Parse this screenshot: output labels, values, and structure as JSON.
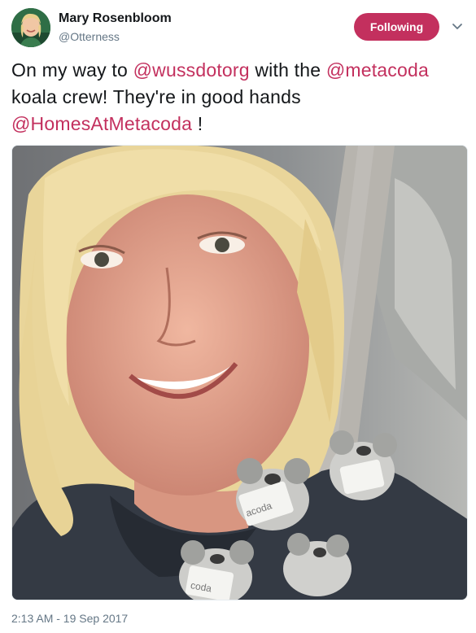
{
  "author": {
    "name": "Mary Rosenbloom",
    "handle": "@Otterness",
    "avatar_icon": "profile-photo"
  },
  "follow_button": {
    "label": "Following",
    "color": "#c3305e"
  },
  "menu": {
    "icon": "chevron-down-icon"
  },
  "tweet": {
    "text_1": "On my way to ",
    "mention_1": "@wussdotorg",
    "text_2": " with the ",
    "mention_2": "@metacoda",
    "text_3": " koala crew!  They're in good hands ",
    "mention_3": "@HomesAtMetacoda",
    "text_4": " !"
  },
  "photo": {
    "description_icon": "selfie-photo",
    "koala_tag_1": "acoda",
    "koala_tag_2": "coda"
  },
  "timestamp": "2:13 AM - 19 Sep 2017",
  "colors": {
    "accent": "#c3305e",
    "muted": "#657786",
    "text": "#14171a"
  }
}
